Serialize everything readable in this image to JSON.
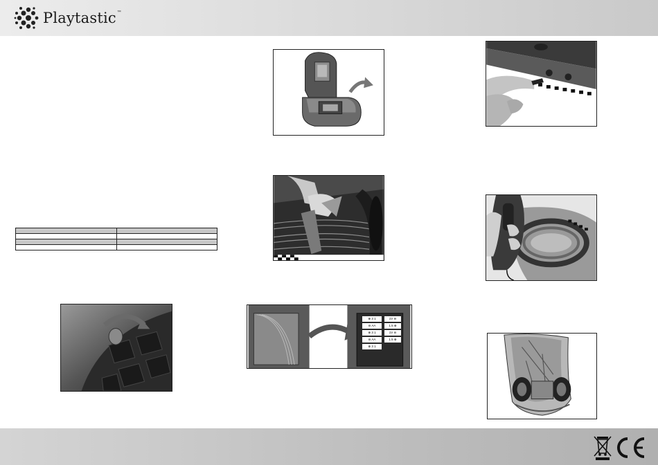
{
  "brand": {
    "name": "Playtastic",
    "tm": "™"
  },
  "spec_table": {
    "rows": [
      [
        "",
        ""
      ],
      [
        "",
        ""
      ],
      [
        "",
        ""
      ],
      [
        "",
        ""
      ]
    ]
  },
  "images": {
    "tire": {
      "alt": "Tire with arrow"
    },
    "battery_case": {
      "alt": "Opening battery compartment"
    },
    "connector": {
      "alt": "Connecting track wires"
    },
    "battery_swap": {
      "alt": "Battery insertion diagram"
    },
    "track_plug": {
      "alt": "Plugging into track"
    },
    "controller": {
      "alt": "Holding hand controller"
    },
    "car_underside": {
      "alt": "Car underside"
    }
  },
  "battery_labels": [
    "⊕ 3 1",
    "1V ⊖",
    "⊖ AA",
    "1.5 ⊕",
    "⊕ 3 1",
    "1V ⊖",
    "⊖ AA",
    "1.5 ⊕",
    "⊕ 3 1"
  ],
  "certifications": [
    "WEEE",
    "CE"
  ],
  "colors": {
    "header_bg": "#d9d9d9",
    "footer_bg": "#bdbdbd",
    "border": "#222222"
  }
}
